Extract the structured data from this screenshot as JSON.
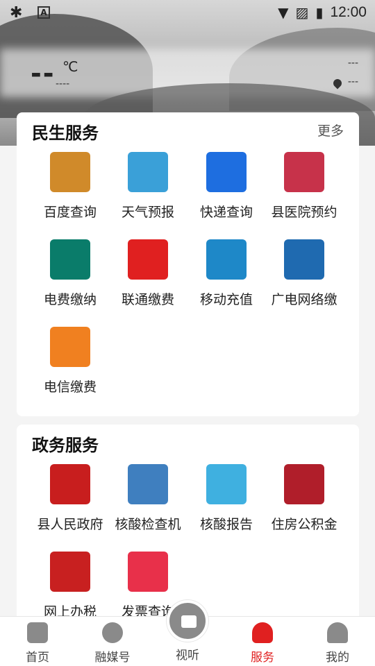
{
  "status": {
    "time": "12:00"
  },
  "weather": {
    "temp": "--",
    "unit": "℃",
    "sub": "----",
    "right_top": "---",
    "right_bottom": "---"
  },
  "minsheng": {
    "title": "民生服务",
    "more": "更多",
    "items": [
      {
        "label": "百度查询",
        "icon": "autumn-tree-icon",
        "color": "#d08a2a"
      },
      {
        "label": "天气预报",
        "icon": "weather-forecast-icon",
        "color": "#3aa0d8"
      },
      {
        "label": "快递查询",
        "icon": "express-100-icon",
        "color": "#1e6ee0"
      },
      {
        "label": "县医院预约",
        "icon": "hospital-emblem-icon",
        "color": "#c7324a"
      },
      {
        "label": "电费缴纳",
        "icon": "state-grid-icon",
        "color": "#0a7c6a"
      },
      {
        "label": "联通缴费",
        "icon": "china-unicom-icon",
        "color": "#e02020"
      },
      {
        "label": "移动充值",
        "icon": "china-mobile-icon",
        "color": "#1e88c8"
      },
      {
        "label": "广电网络缴",
        "icon": "scn-tv-icon",
        "color": "#1f6ab0"
      },
      {
        "label": "电信缴费",
        "icon": "china-telecom-icon",
        "color": "#f08020"
      }
    ]
  },
  "zhengwu": {
    "title": "政务服务",
    "items": [
      {
        "label": "县人民政府",
        "icon": "government-seal-icon",
        "color": "#c81e1e"
      },
      {
        "label": "核酸检查机",
        "icon": "house-icon",
        "color": "#3f7fbf"
      },
      {
        "label": "核酸报告",
        "icon": "clipboard-icon",
        "color": "#3fb0e0"
      },
      {
        "label": "住房公积金",
        "icon": "housing-fund-icon",
        "color": "#b01e2a"
      },
      {
        "label": "网上办税",
        "icon": "tax-emblem-icon",
        "color": "#c82020"
      },
      {
        "label": "发票查询",
        "icon": "invoice-query-icon",
        "color": "#e8304a"
      }
    ]
  },
  "tabs": [
    {
      "label": "首页",
      "icon": "home-icon"
    },
    {
      "label": "融媒号",
      "icon": "globe-icon"
    },
    {
      "label": "视听",
      "icon": "play-video-icon"
    },
    {
      "label": "服务",
      "icon": "heart-icon",
      "active": true
    },
    {
      "label": "我的",
      "icon": "user-icon"
    }
  ]
}
